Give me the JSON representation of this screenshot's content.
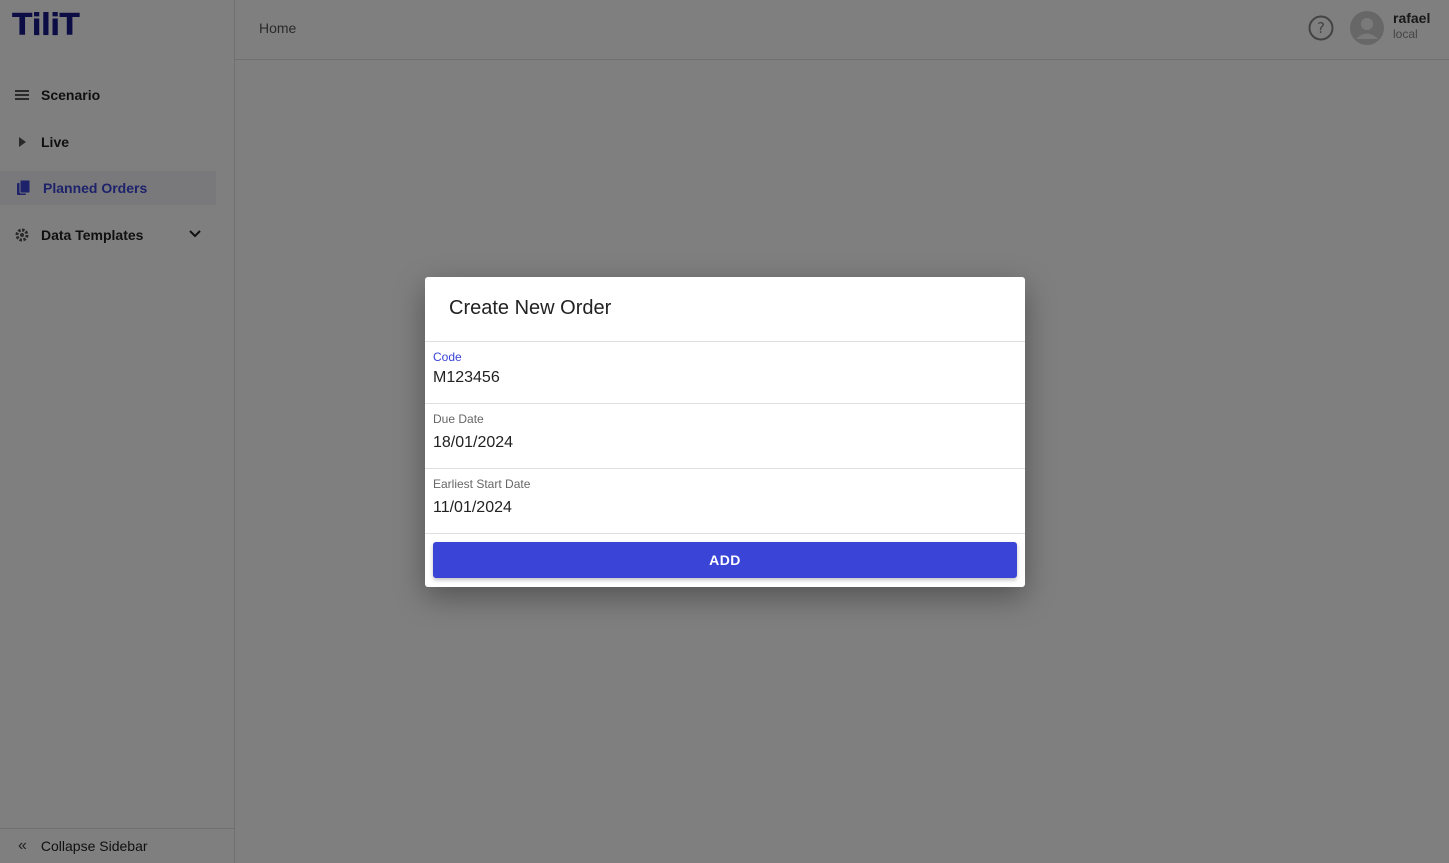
{
  "app": {
    "logo_text": "TiliT",
    "brand_color": "#1a1a8c",
    "accent_color": "#3a44d6"
  },
  "sidebar": {
    "items": [
      {
        "label": "Scenario",
        "icon": "list-icon"
      },
      {
        "label": "Live",
        "icon": "play-icon"
      },
      {
        "label": "Planned Orders",
        "icon": "documents-icon",
        "active": true
      },
      {
        "label": "Data Templates",
        "icon": "gear-icon",
        "expandable": true
      }
    ],
    "collapse_label": "Collapse Sidebar",
    "collapse_icon": "double-chevron-left-icon"
  },
  "header": {
    "breadcrumb": "Home",
    "help_icon": "help-circle-icon",
    "user": {
      "name": "rafael",
      "realm": "local",
      "avatar_icon": "user-avatar-icon"
    }
  },
  "dialog": {
    "title": "Create New Order",
    "fields": [
      {
        "label": "Code",
        "value": "M123456",
        "focused": true
      },
      {
        "label": "Due Date",
        "value": "18/01/2024"
      },
      {
        "label": "Earliest Start Date",
        "value": "11/01/2024"
      }
    ],
    "submit_label": "ADD"
  }
}
